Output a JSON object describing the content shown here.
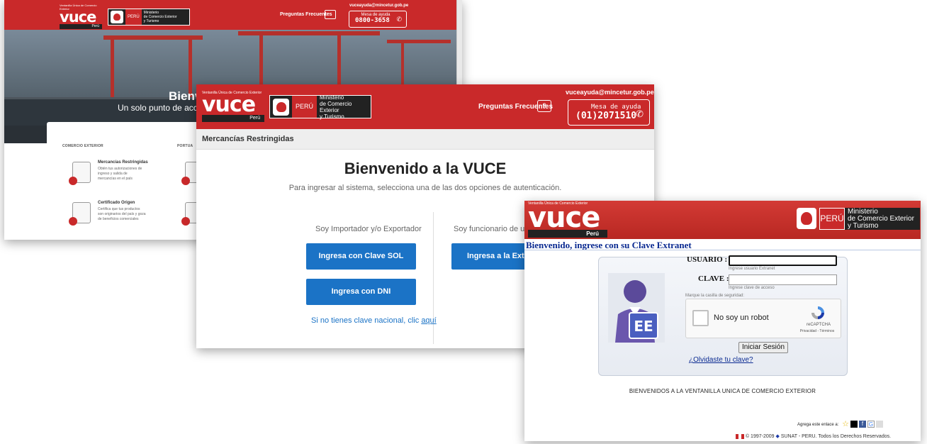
{
  "window_back": {
    "logo_tagline": "Ventanilla Única de Comercio Exterior",
    "logo_word": "vuce",
    "logo_country": "Perú",
    "peru": "PERÚ",
    "ministry": [
      "Ministerio",
      "de Comercio Exterior",
      "y Turismo"
    ],
    "faq": "Preguntas Frecuentes",
    "email": "vuceayuda@mincetur.gob.pe",
    "help_label": "Mesa de ayuda",
    "help_phone": "0800-3658",
    "hero_title": "Bienv",
    "hero_subtitle": "Un solo punto de acceso p",
    "section_1": "COMERCIO EXTERIOR",
    "section_2": "PORTUA",
    "services": [
      {
        "title": "Mercancías Restringidas",
        "desc": [
          "Obtén tus autorizaciones de",
          "ingreso y salida de",
          "mercancías en el país"
        ]
      },
      {
        "title": "Certificado Origen",
        "desc": [
          "Certifica que tus productos",
          "son originarios del país y goza",
          "de beneficios comerciales"
        ]
      }
    ]
  },
  "window_middle": {
    "logo_tagline": "Ventanilla Única de Comercio Exterior",
    "logo_word": "vuce",
    "logo_country": "Perú",
    "peru": "PERÚ",
    "ministry": [
      "Ministerio",
      "de Comercio Exterior",
      "y Turismo"
    ],
    "faq": "Preguntas Frecuentes",
    "email": "vuceayuda@mincetur.gob.pe",
    "help_label": "Mesa de ayuda",
    "help_phone": "(01)2071510",
    "breadcrumb": "Mercancías Restringidas",
    "title": "Bienvenido a la VUCE",
    "subtitle": "Para ingresar al sistema, selecciona una de las dos opciones de autenticación.",
    "option_left": "Soy Importador y/o Exportador",
    "option_right": "Soy funcionario de una E",
    "btn_sol": "Ingresa con Clave SOL",
    "btn_dni": "Ingresa con DNI",
    "btn_extranet": "Ingresa a la Extrane",
    "no_key_text": "Si no tienes clave nacional, clic ",
    "no_key_link": "aquí"
  },
  "window_front": {
    "logo_tagline": "Ventanilla Única de Comercio Exterior",
    "logo_word": "vuce",
    "logo_country": "Perú",
    "peru": "PERÚ",
    "ministry": [
      "Ministerio",
      "de Comercio Exterior",
      "y Turismo"
    ],
    "welcome": "Bienvenido, ingrese con su Clave Extranet",
    "user_label": "USUARIO :",
    "user_hint": "Ingrese usuario Extranet",
    "key_label": "CLAVE :",
    "key_hint": "Ingrese clave de acceso",
    "security_prompt": "Marque la casilla de seguridad:",
    "captcha_text": "No soy un robot",
    "captcha_brand": "reCAPTCHA",
    "captcha_links": "Privacidad - Términos",
    "login_button": "Iniciar Sesión",
    "forgot": "¿Olvidaste tu clave?",
    "avatar_text": "EE",
    "banner": "BIENVENIDOS A LA VENTANILLA UNICA DE COMERCIO EXTERIOR",
    "add_link": "Agrega este enlace a:",
    "copyright": "© 1997-2009",
    "copyright_tail": "SUNAT - PERU. Todos los Derechos Reservados."
  },
  "colors": {
    "brand_red": "#c9292a",
    "button_blue": "#1b73c6",
    "link_navy": "#0a2a91"
  }
}
